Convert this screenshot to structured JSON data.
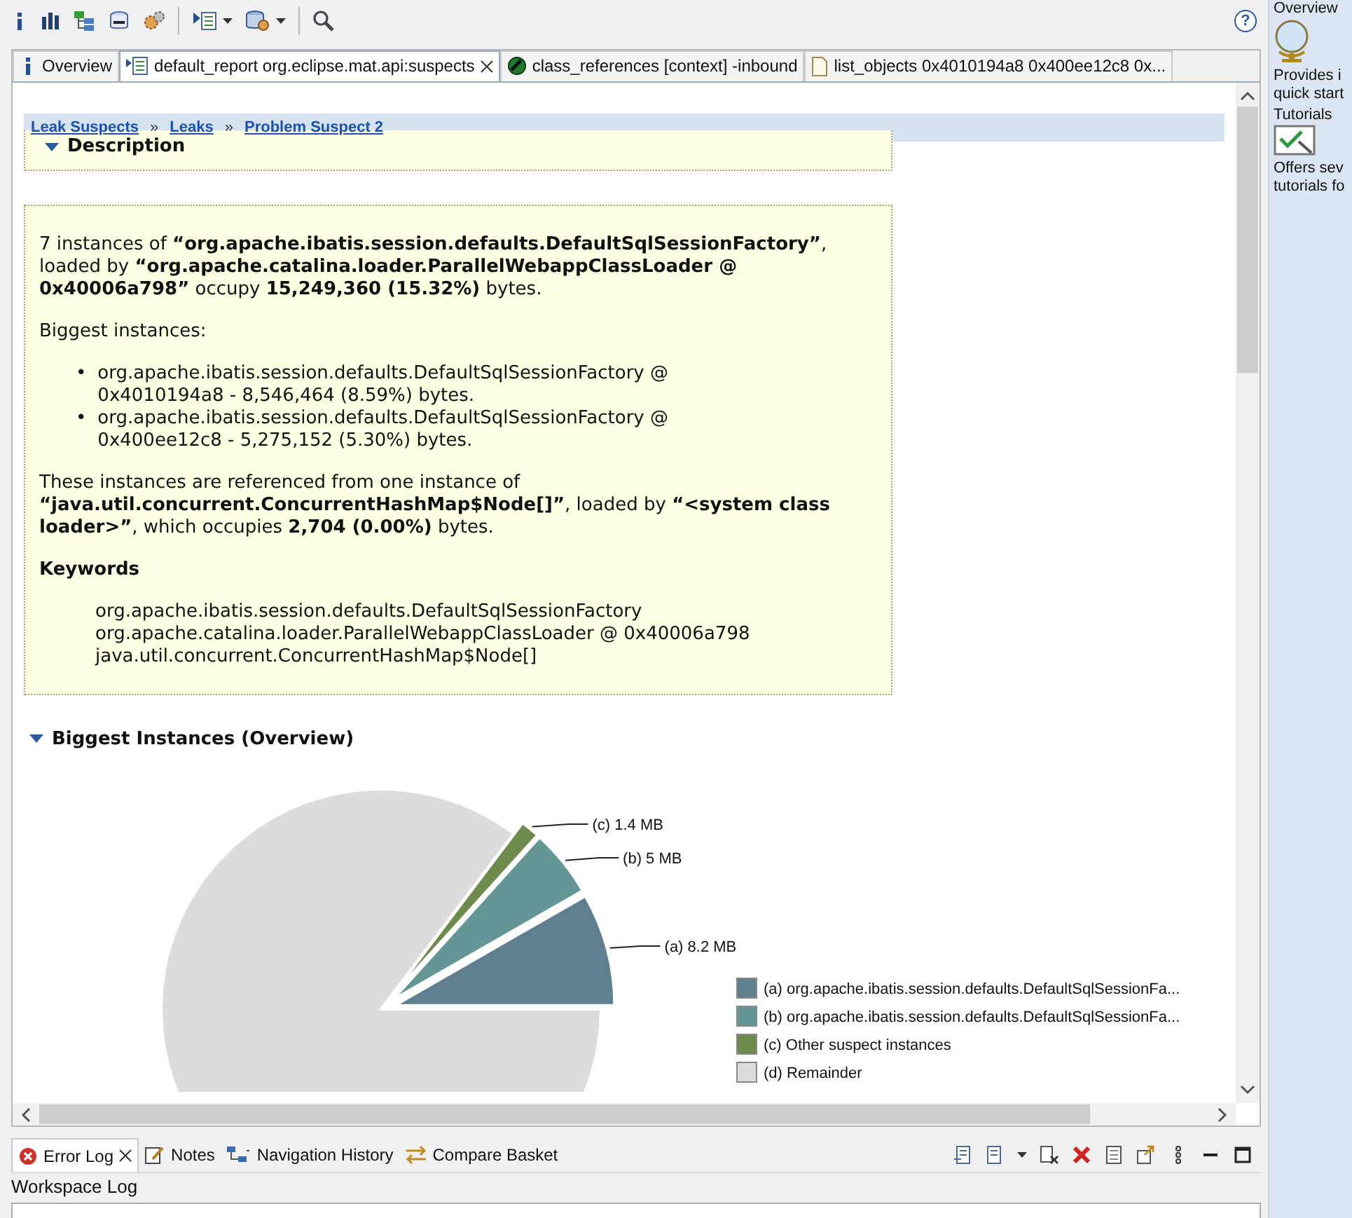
{
  "toolbar": {
    "help_button": "?"
  },
  "side_panel": {
    "items": [
      {
        "title": "Overview",
        "text": [
          "Provides i",
          "quick start"
        ]
      },
      {
        "title": "Tutorials",
        "text": [
          "Offers sev",
          "tutorials fo"
        ]
      }
    ]
  },
  "editor_tabs": [
    {
      "label": "Overview",
      "selected": false,
      "closable": false
    },
    {
      "label": "default_report org.eclipse.mat.api:suspects",
      "selected": true,
      "closable": true
    },
    {
      "label": "class_references [context] -inbound",
      "selected": false,
      "closable": false
    },
    {
      "label": "list_objects 0x4010194a8 0x400ee12c8 0x...",
      "selected": false,
      "closable": false
    }
  ],
  "breadcrumb": [
    "Leak Suspects",
    "Leaks",
    "Problem Suspect 2"
  ],
  "breadcrumb_separator": "»",
  "description": {
    "title": "Description",
    "expanded": true,
    "paragraph_1": "7 instances of **“org.apache.ibatis.session.defaults.DefaultSqlSessionFactory”**, loaded by **“org.apache.catalina.loader.ParallelWebappClassLoader @ 0x40006a798”** occupy **15,249,360 (15.32%)** bytes.",
    "biggest_label": "Biggest instances:",
    "list_marker": "•",
    "biggest_instances": [
      "org.apache.ibatis.session.defaults.DefaultSqlSessionFactory @ 0x4010194a8 - 8,546,464 (8.59%) bytes.",
      "org.apache.ibatis.session.defaults.DefaultSqlSessionFactory @ 0x400ee12c8 - 5,275,152 (5.30%) bytes."
    ],
    "paragraph_2": "These instances are referenced from one instance of **“java.util.concurrent.ConcurrentHashMap$Node[]”**, loaded by **“<system class loader>”**, which occupies **2,704 (0.00%)** bytes.",
    "keywords_title": "Keywords",
    "keywords": [
      "org.apache.ibatis.session.defaults.DefaultSqlSessionFactory",
      "org.apache.catalina.loader.ParallelWebappClassLoader @ 0x40006a798",
      "java.util.concurrent.ConcurrentHashMap$Node[]"
    ]
  },
  "overview": {
    "title": "Biggest Instances (Overview)",
    "expanded": true,
    "pie": {
      "slices": [
        {
          "label": "(a)  8.2 MB",
          "color": "#5f7f8f"
        },
        {
          "label": "(b)  5 MB",
          "color": "#659696"
        },
        {
          "label": "(c)  1.4 MB",
          "color": "#6f8a4d"
        },
        {
          "color": "#dcdcdc"
        }
      ],
      "legend": [
        {
          "label": "(a)  org.apache.ibatis.session.defaults.DefaultSqlSessionFa...",
          "color": "#5f7f8f"
        },
        {
          "label": "(b)  org.apache.ibatis.session.defaults.DefaultSqlSessionFa...",
          "color": "#659696"
        },
        {
          "label": "(c)  Other suspect instances",
          "color": "#6f8a4d"
        },
        {
          "label": "(d)  Remainder",
          "color": "#dcdcdc"
        }
      ]
    }
  },
  "bottom_tabs": [
    {
      "label": "Error Log",
      "selected": true,
      "closable": true
    },
    {
      "label": "Notes",
      "selected": false,
      "closable": false
    },
    {
      "label": "Navigation History",
      "selected": false,
      "closable": false
    },
    {
      "label": "Compare Basket",
      "selected": false,
      "closable": false
    }
  ],
  "bottom_view_title": "Workspace Log"
}
